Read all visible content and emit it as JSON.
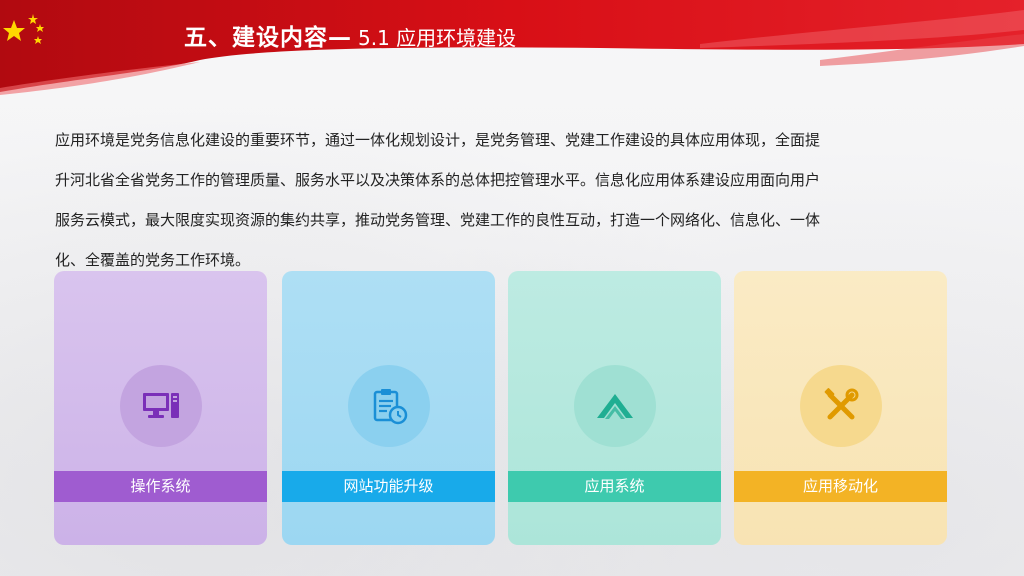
{
  "header": {
    "title": "五、建设内容—",
    "subtitle": "5.1 应用环境建设"
  },
  "intro": {
    "lines": [
      "应用环境是党务信息化建设的重要环节，通过一体化规划设计，是党务管理、党建工作建设的具体应用体现，全面提",
      "升河北省全省党务工作的管理质量、服务水平以及决策体系的总体把控管理水平。信息化应用体系建设应用面向用户",
      "服务云模式，最大限度实现资源的集约共享，推动党务管理、党建工作的良性互动，打造一个网络化、信息化、一体",
      "化、全覆盖的党务工作环境。"
    ]
  },
  "cards": [
    {
      "label": "操作系统",
      "icon": "computer-icon",
      "color": "#9f5cd0"
    },
    {
      "label": "网站功能升级",
      "icon": "clipboard-clock-icon",
      "color": "#18aaea"
    },
    {
      "label": "应用系统",
      "icon": "chevron-peak-icon",
      "color": "#3ecaae"
    },
    {
      "label": "应用移动化",
      "icon": "tools-icon",
      "color": "#f3b325"
    }
  ],
  "colors": {
    "banner_red": "#d80f16",
    "star_yellow": "#ffd700",
    "text": "#222222"
  }
}
